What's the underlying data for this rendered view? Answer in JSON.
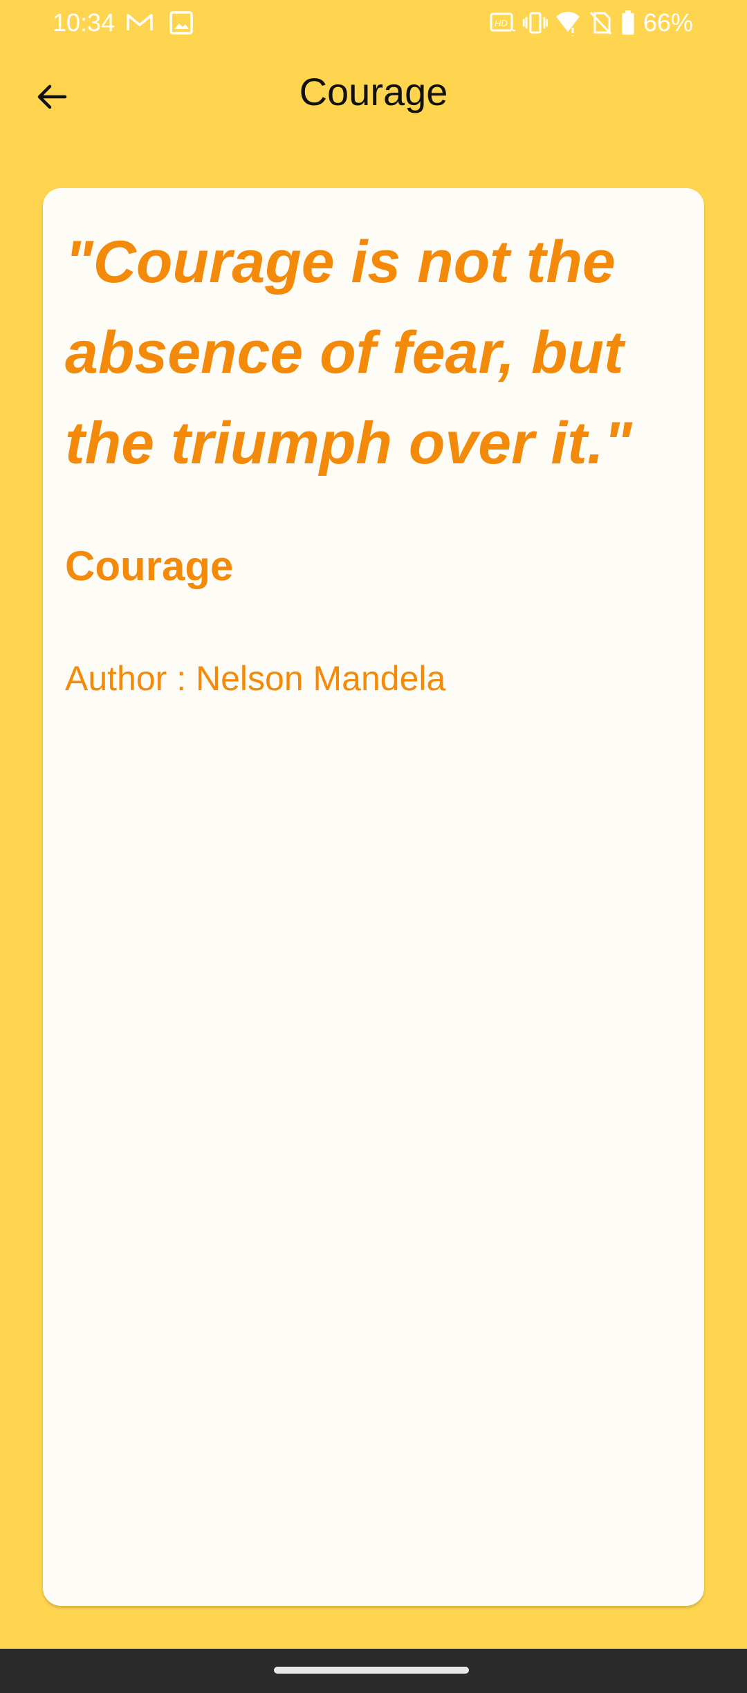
{
  "status_bar": {
    "time": "10:34",
    "battery_percent": "66%",
    "icons": [
      "gmail-icon",
      "image-icon",
      "hd-icon",
      "vibrate-icon",
      "wifi-icon",
      "no-sim-icon",
      "battery-icon"
    ]
  },
  "app_bar": {
    "title": "Courage",
    "back_icon": "arrow-left-icon"
  },
  "quote": {
    "text": "\"Courage is not the absence of fear, but the triumph over it.\"",
    "category": "Courage",
    "author": "Author : Nelson Mandela"
  },
  "colors": {
    "background": "#FFD54F",
    "card": "#FEFCF7",
    "accent": "#F48A0A",
    "nav_bar": "#2B2B2B"
  }
}
